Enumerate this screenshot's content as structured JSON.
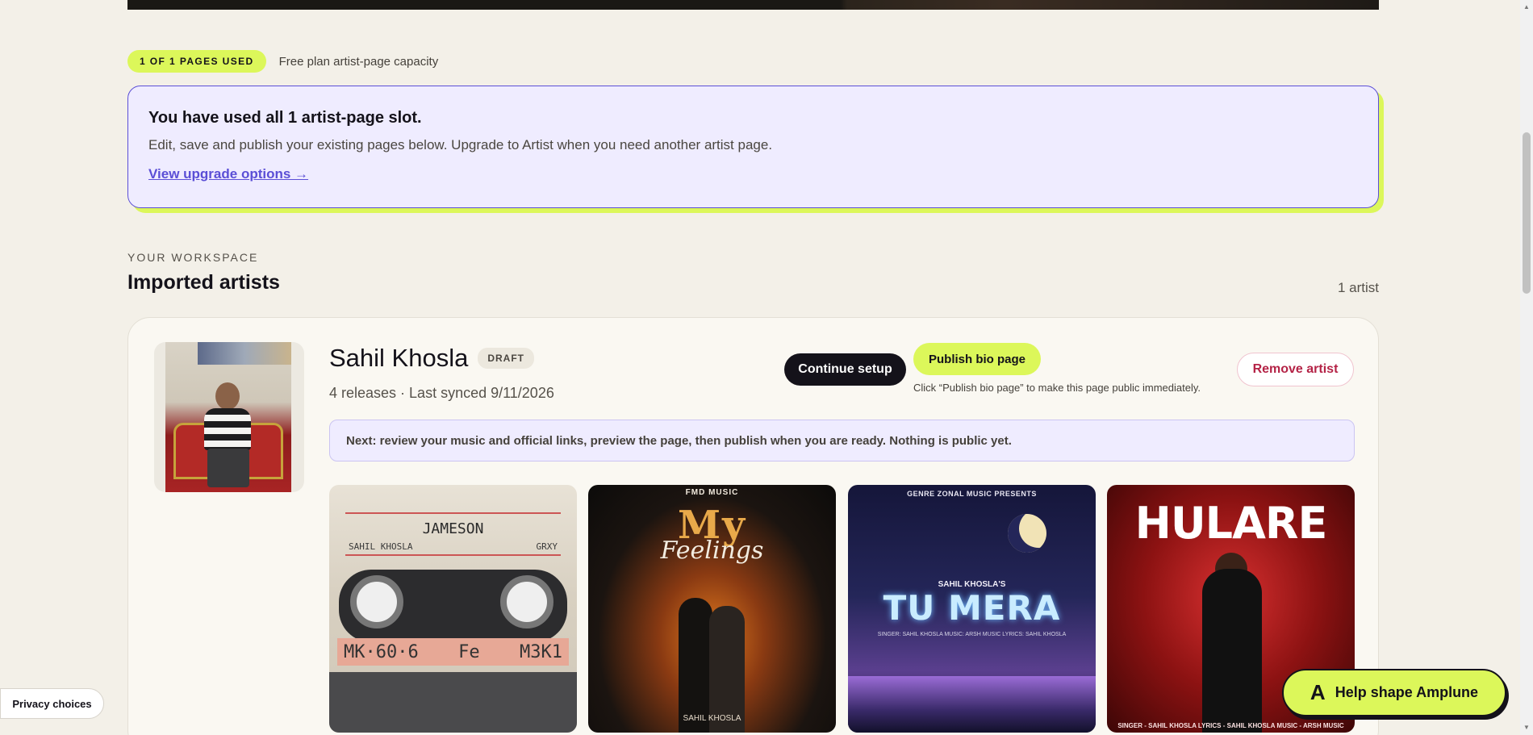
{
  "capacity": {
    "badge": "1 OF 1 PAGES USED",
    "note": "Free plan artist-page capacity"
  },
  "limit_card": {
    "title": "You have used all 1 artist-page slot.",
    "description": "Edit, save and publish your existing pages below. Upgrade to Artist when you need another artist page.",
    "link": "View upgrade options →"
  },
  "workspace": {
    "eyebrow": "YOUR WORKSPACE",
    "title": "Imported artists",
    "count": "1 artist"
  },
  "artist": {
    "name": "Sahil Khosla",
    "status": "DRAFT",
    "meta": "4 releases · Last synced 9/11/2026",
    "continue_label": "Continue setup",
    "publish_label": "Publish bio page",
    "publish_hint": "Click “Publish bio page” to make this page public immediately.",
    "remove_label": "Remove artist",
    "next_banner": "Next: review your music and official links, preview the page, then publish when you are ready. Nothing is public yet."
  },
  "releases": [
    {
      "title": "JAMESON",
      "artist_text": "SAHIL KHOSLA",
      "tag": "GRXY",
      "code_left": "MK·60·6",
      "code_mid": "Fe",
      "code_right": "M3K1"
    },
    {
      "label": "FMD MUSIC",
      "title": "My",
      "script": "Feelings",
      "credit": "SAHIL KHOSLA"
    },
    {
      "label": "GENRE ZONAL MUSIC PRESENTS",
      "artist_line": "SAHIL KHOSLA'S",
      "title": "TU MERA",
      "credits": "SINGER: SAHIL KHOSLA  MUSIC: ARSH MUSIC  LYRICS: SAHIL KHOSLA"
    },
    {
      "title": "HULARE",
      "credit": "SINGER - SAHIL KHOSLA LYRICS - SAHIL KHOSLA MUSIC - ARSH MUSIC"
    }
  ],
  "footer": {
    "privacy_label": "Privacy choices",
    "feedback_label": "Help shape Amplune",
    "feedback_glyph": "A"
  },
  "colors": {
    "accent_lime": "#dcf75a",
    "accent_violet": "#5b4fd6",
    "danger": "#b42346",
    "ink": "#14121a",
    "page_bg": "#f3f0e8"
  }
}
